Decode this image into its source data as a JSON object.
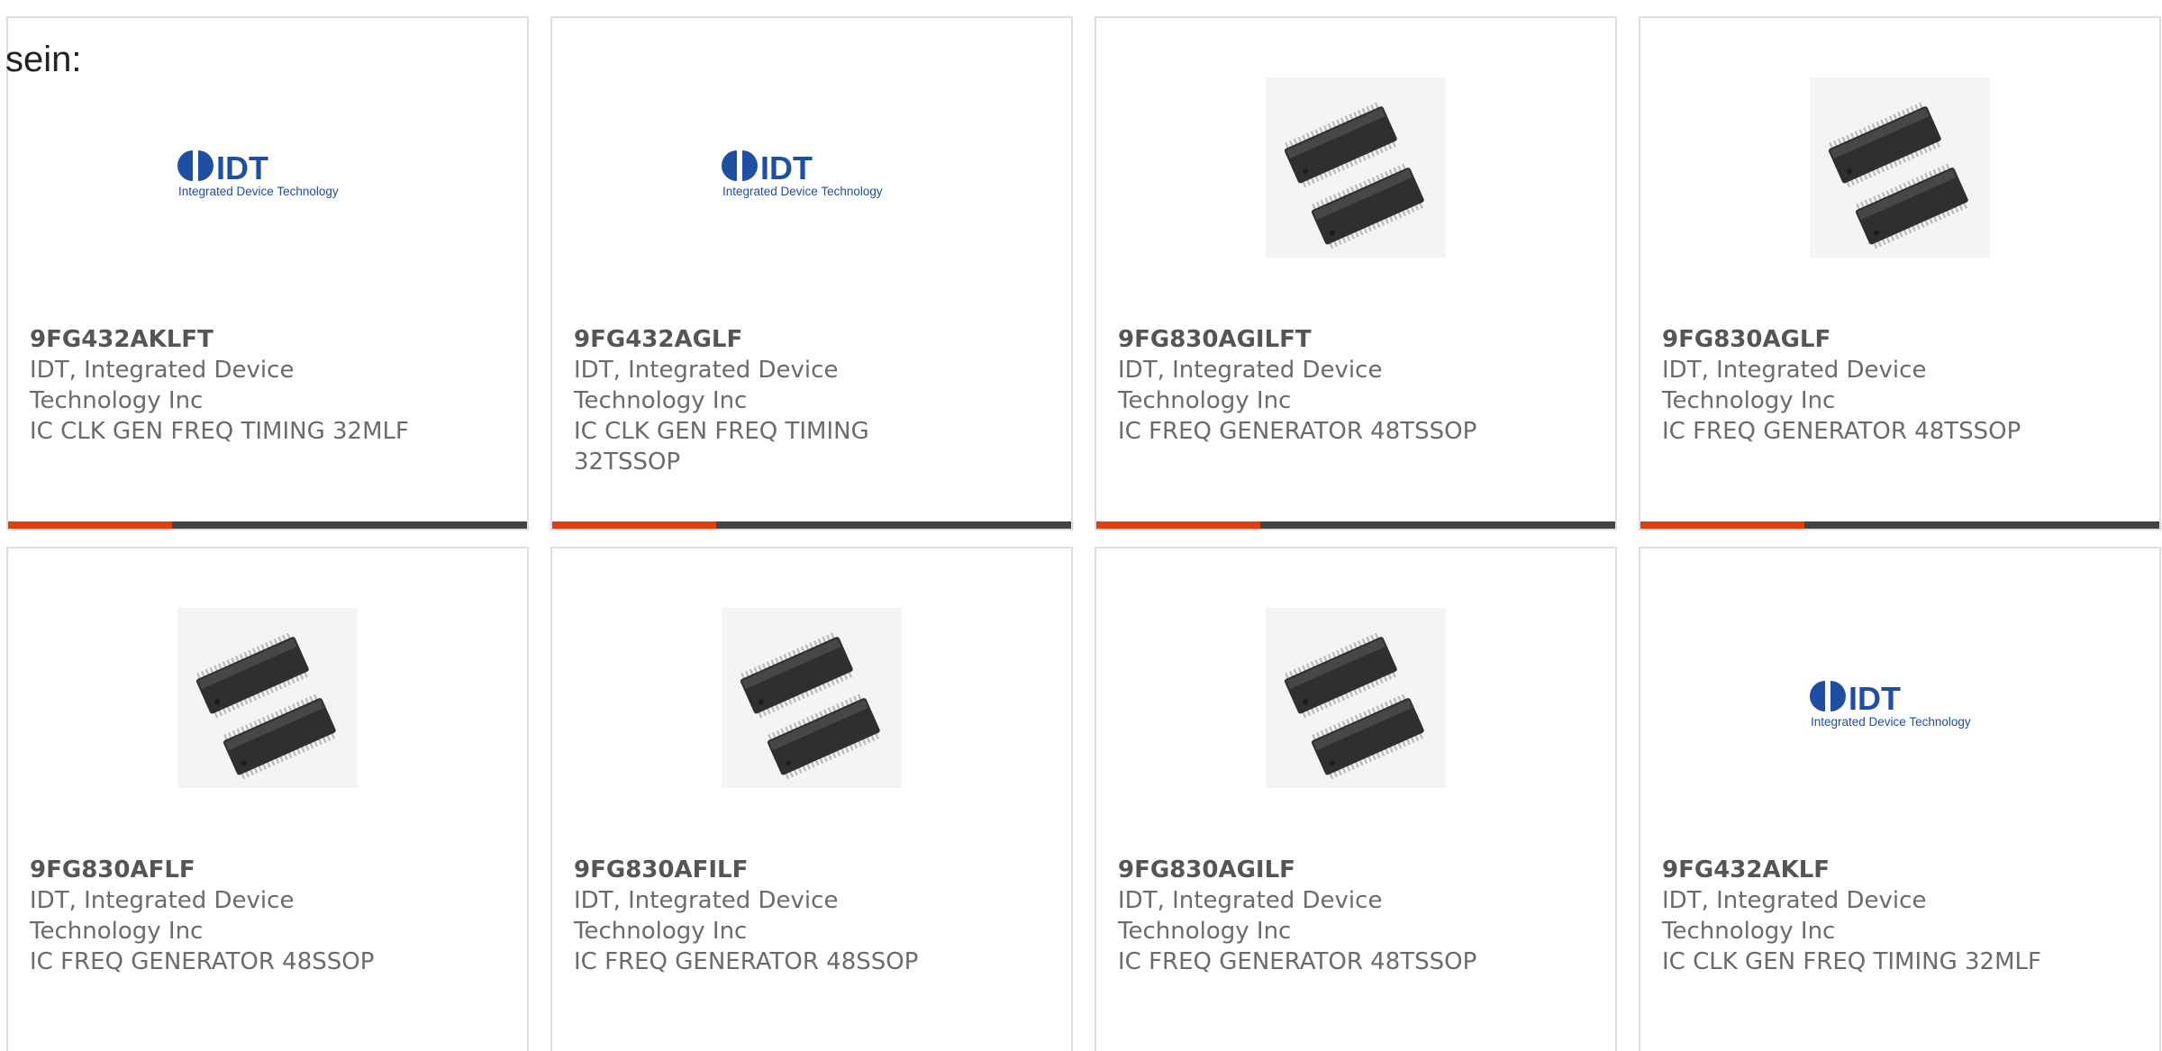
{
  "intro_text": "sein:",
  "colors": {
    "accent": "#e03e0e",
    "bar_dark": "#444444",
    "border": "#dedede",
    "text": "#6b6b6b"
  },
  "products": [
    {
      "part_number": "9FG432AKLFT",
      "manufacturer": "IDT, Integrated Device Technology Inc",
      "description": "IC CLK GEN FREQ TIMING 32MLF",
      "image": "idt-logo",
      "logo_text": "IDT",
      "logo_sub": "Integrated Device Technology"
    },
    {
      "part_number": "9FG432AGLF",
      "manufacturer": "IDT, Integrated Device Technology Inc",
      "description": "IC CLK GEN FREQ TIMING 32TSSOP",
      "image": "idt-logo",
      "logo_text": "IDT",
      "logo_sub": "Integrated Device Technology"
    },
    {
      "part_number": "9FG830AGILFT",
      "manufacturer": "IDT, Integrated Device Technology Inc",
      "description": "IC FREQ GENERATOR 48TSSOP",
      "image": "ic-chip-photo"
    },
    {
      "part_number": "9FG830AGLF",
      "manufacturer": "IDT, Integrated Device Technology Inc",
      "description": "IC FREQ GENERATOR 48TSSOP",
      "image": "ic-chip-photo"
    },
    {
      "part_number": "9FG830AFLF",
      "manufacturer": "IDT, Integrated Device Technology Inc",
      "description": "IC FREQ GENERATOR 48SSOP",
      "image": "ic-chip-photo"
    },
    {
      "part_number": "9FG830AFILF",
      "manufacturer": "IDT, Integrated Device Technology Inc",
      "description": "IC FREQ GENERATOR 48SSOP",
      "image": "ic-chip-photo"
    },
    {
      "part_number": "9FG830AGILF",
      "manufacturer": "IDT, Integrated Device Technology Inc",
      "description": "IC FREQ GENERATOR 48TSSOP",
      "image": "ic-chip-photo"
    },
    {
      "part_number": "9FG432AKLF",
      "manufacturer": "IDT, Integrated Device Technology Inc",
      "description": "IC CLK GEN FREQ TIMING 32MLF",
      "image": "idt-logo",
      "logo_text": "IDT",
      "logo_sub": "Integrated Device Technology"
    }
  ]
}
